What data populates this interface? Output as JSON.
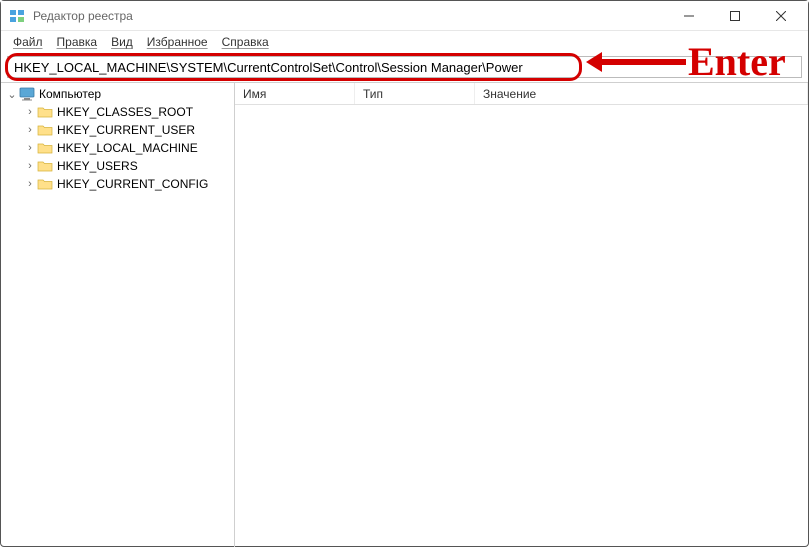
{
  "window": {
    "title": "Редактор реестра"
  },
  "menu": {
    "file": "Файл",
    "edit": "Правка",
    "view": "Вид",
    "favorites": "Избранное",
    "help": "Справка"
  },
  "address": {
    "value": "HKEY_LOCAL_MACHINE\\SYSTEM\\CurrentControlSet\\Control\\Session Manager\\Power"
  },
  "annotation": {
    "enter": "Enter"
  },
  "tree": {
    "root": "Компьютер",
    "items": [
      "HKEY_CLASSES_ROOT",
      "HKEY_CURRENT_USER",
      "HKEY_LOCAL_MACHINE",
      "HKEY_USERS",
      "HKEY_CURRENT_CONFIG"
    ]
  },
  "columns": {
    "name": "Имя",
    "type": "Тип",
    "value": "Значение"
  }
}
